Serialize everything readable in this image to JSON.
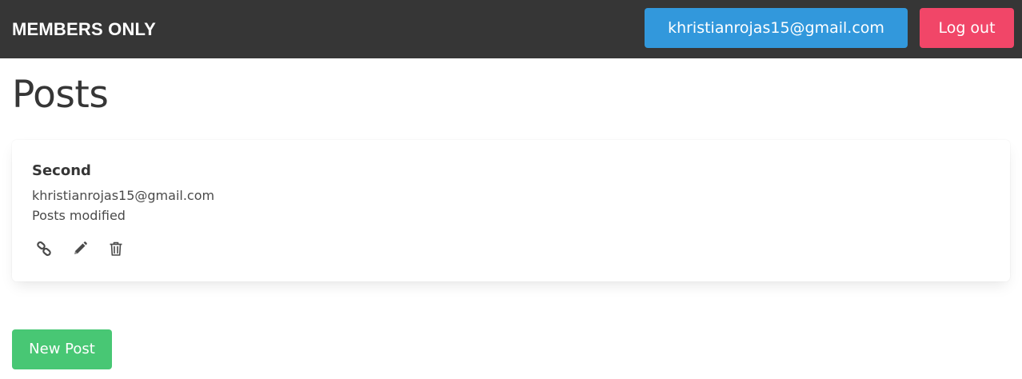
{
  "navbar": {
    "brand": "MEMBERS ONLY",
    "user_email": "khristianrojas15@gmail.com",
    "logout_label": "Log out"
  },
  "page": {
    "title": "Posts"
  },
  "posts": [
    {
      "title": "Second",
      "author": "khristianrojas15@gmail.com",
      "body": "Posts modified",
      "actions": [
        "link-icon",
        "pencil-icon",
        "trash-icon"
      ]
    }
  ],
  "footer": {
    "new_post_label": "New Post"
  },
  "colors": {
    "navbar_bg": "#363636",
    "email_button": "#3298dc",
    "logout_button": "#f14668",
    "new_post_button": "#48c774"
  }
}
